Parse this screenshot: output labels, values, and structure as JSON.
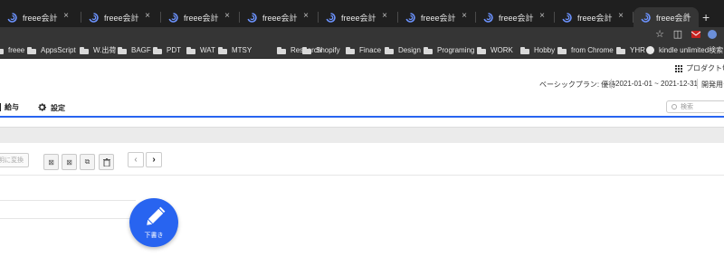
{
  "tabs": [
    {
      "label": "freee会計",
      "icon": "freee-logo-icon"
    },
    {
      "label": "freee会計",
      "icon": "freee-logo-icon"
    },
    {
      "label": "freee会計",
      "icon": "freee-logo-icon"
    },
    {
      "label": "freee会計",
      "icon": "freee-logo-icon"
    },
    {
      "label": "freee会計",
      "icon": "freee-logo-icon"
    },
    {
      "label": "freee会計",
      "icon": "freee-logo-icon"
    },
    {
      "label": "freee会計",
      "icon": "freee-logo-icon"
    },
    {
      "label": "freee会計",
      "icon": "freee-logo-icon"
    },
    {
      "label": "freee会計",
      "icon": "freee-logo-icon",
      "active": true
    }
  ],
  "new_tab_label": "+",
  "bookmarks": [
    {
      "label": "freee",
      "type": "folder"
    },
    {
      "label": "AppsScript",
      "type": "folder"
    },
    {
      "label": "W.出荷",
      "type": "folder"
    },
    {
      "label": "BAGF",
      "type": "folder"
    },
    {
      "label": "PDT",
      "type": "folder"
    },
    {
      "label": "WAT",
      "type": "folder"
    },
    {
      "label": "MTSY",
      "type": "folder"
    },
    {
      "label": "Research",
      "type": "folder"
    },
    {
      "label": "Shopify",
      "type": "folder"
    },
    {
      "label": "Finace",
      "type": "folder"
    },
    {
      "label": "Design",
      "type": "folder"
    },
    {
      "label": "Programing",
      "type": "folder"
    },
    {
      "label": "WORK",
      "type": "folder"
    },
    {
      "label": "Hobby",
      "type": "folder"
    },
    {
      "label": "from Chrome",
      "type": "folder"
    },
    {
      "label": "YHR",
      "type": "folder"
    },
    {
      "label": "kindle unlimited検索",
      "type": "site"
    }
  ],
  "header": {
    "product_switch": "プロダクト切替",
    "plan": "ベーシックプラン: 優待",
    "period": "2021-01-01 ~ 2021-12-31",
    "dev": "開発用テ"
  },
  "nav": {
    "payroll": "給与",
    "settings": "設定",
    "search_placeholder": "検索"
  },
  "actions": {
    "convert": "明に変換",
    "prev": "‹",
    "next": "›"
  },
  "fab": {
    "label": "下書き"
  },
  "colors": {
    "accent": "#2864f0",
    "tab_bg": "#1f1f1f",
    "toolbar_bg": "#353535"
  }
}
